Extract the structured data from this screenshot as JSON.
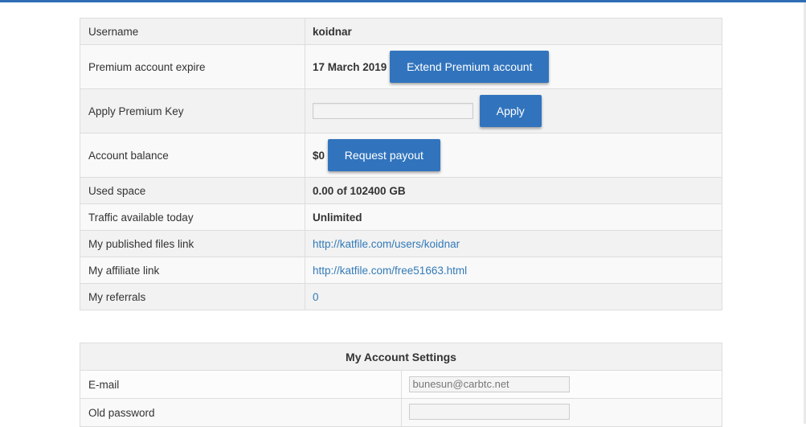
{
  "account": {
    "username_label": "Username",
    "username": "koidnar",
    "premium_label": "Premium account expire",
    "premium_expire": "17 March 2019",
    "extend_button": "Extend Premium account",
    "apply_key_label": "Apply Premium Key",
    "apply_key_value": "",
    "apply_button": "Apply",
    "balance_label": "Account balance",
    "balance": "$0",
    "payout_button": "Request payout",
    "used_space_label": "Used space",
    "used_space": "0.00 of 102400 GB",
    "traffic_label": "Traffic available today",
    "traffic": "Unlimited",
    "published_label": "My published files link",
    "published_link": "http://katfile.com/users/koidnar",
    "affiliate_label": "My affiliate link",
    "affiliate_link": "http://katfile.com/free51663.html",
    "referrals_label": "My referrals",
    "referrals": "0"
  },
  "settings": {
    "title": "My Account Settings",
    "email_label": "E-mail",
    "email_value": "bunesun@carbtc.net",
    "old_password_label": "Old password",
    "old_password_value": ""
  },
  "colors": {
    "accent": "#3174bd",
    "link": "#337ab7",
    "top_strip": "#2e6db4"
  }
}
